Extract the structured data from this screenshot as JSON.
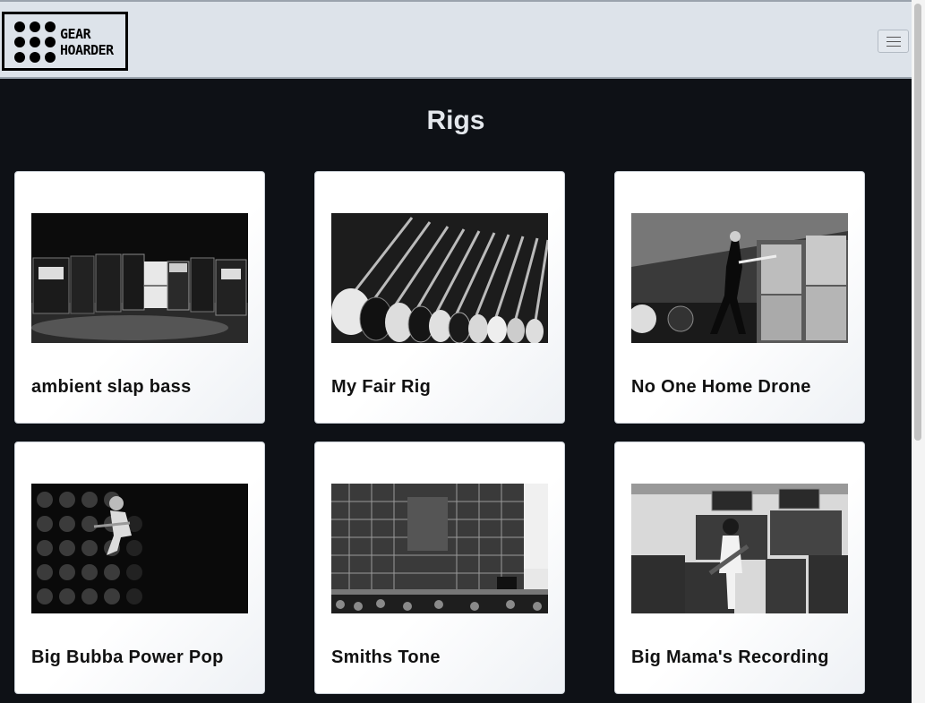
{
  "brand": {
    "logo_line1": "GEAR",
    "logo_line2": "HOARDER"
  },
  "header": {
    "menu_icon": "hamburger-menu-icon"
  },
  "page": {
    "title": "Rigs"
  },
  "rigs": [
    {
      "name": "ambient slap bass"
    },
    {
      "name": "My Fair Rig"
    },
    {
      "name": "No One Home Drone"
    },
    {
      "name": "Big Bubba Power Pop"
    },
    {
      "name": "Smiths Tone"
    },
    {
      "name": "Big Mama's Recording"
    }
  ]
}
